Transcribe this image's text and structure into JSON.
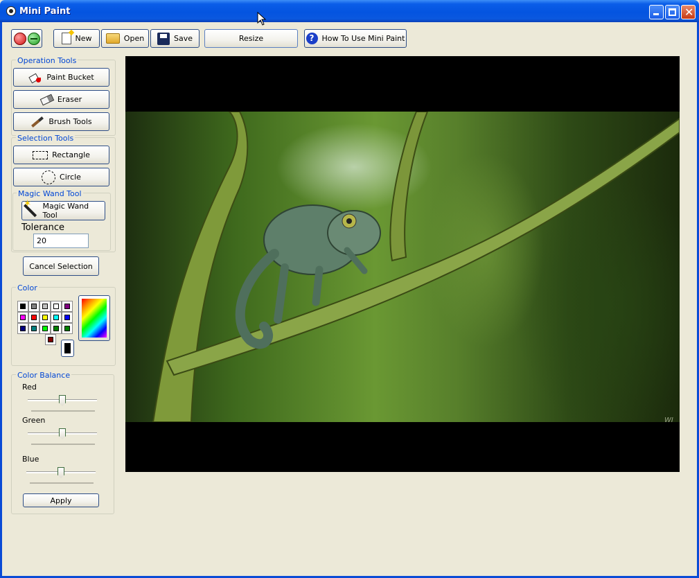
{
  "window": {
    "title": "Mini Paint"
  },
  "toolbar": {
    "new_label": "New",
    "open_label": "Open",
    "save_label": "Save",
    "resize_label": "Resize",
    "help_label": "How To Use Mini Paint"
  },
  "operation_tools": {
    "header": "Operation Tools",
    "paint_bucket": "Paint Bucket",
    "eraser": "Eraser",
    "brush_tools": "Brush Tools"
  },
  "selection_tools": {
    "header": "Selection Tools",
    "rectangle": "Rectangle",
    "circle": "Circle"
  },
  "magic_wand": {
    "header": "Magic Wand Tool",
    "button_label": "Magic Wand Tool",
    "tolerance_label": "Tolerance",
    "tolerance_value": "20"
  },
  "cancel_selection_label": "Cancel Selection",
  "color": {
    "header": "Color",
    "palette": [
      "#000000",
      "#808080",
      "#c0c0c0",
      "#ffffff",
      "#800080",
      "#ff00ff",
      "#ff0000",
      "#ffff00",
      "#00ffff",
      "#0000ff",
      "#000080",
      "#008080",
      "#00ff00",
      "#008000",
      "#008000",
      "#800000"
    ],
    "current_color": "#000000"
  },
  "color_balance": {
    "header": "Color Balance",
    "red_label": "Red",
    "green_label": "Green",
    "blue_label": "Blue",
    "red_value": 0.5,
    "green_value": 0.5,
    "blue_value": 0.5,
    "apply_label": "Apply"
  },
  "image": {
    "watermark": "WJ"
  },
  "icons": [
    "app-icon",
    "close-icon",
    "open-icon",
    "new-file-icon",
    "open-folder-icon",
    "save-disk-icon",
    "help-icon",
    "paint-bucket-icon",
    "eraser-icon",
    "brush-icon",
    "rectangle-select-icon",
    "circle-select-icon",
    "magic-wand-icon",
    "color-spectrum-icon"
  ]
}
